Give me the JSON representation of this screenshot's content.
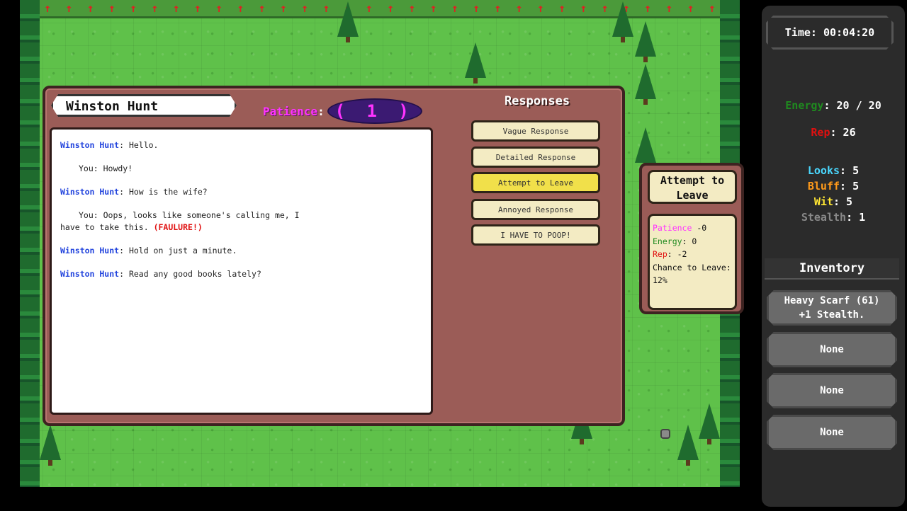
{
  "dialog": {
    "npc_name": "Winston Hunt",
    "patience_label": "Patience",
    "patience_value": "( 1 )",
    "messages": [
      {
        "speaker": "Winston Hunt",
        "text": ": Hello.",
        "is_you": false
      },
      {
        "speaker": "You",
        "text": "You: Howdy!",
        "is_you": true
      },
      {
        "speaker": "Winston Hunt",
        "text": ": How is the wife?",
        "is_you": false
      },
      {
        "speaker": "You",
        "text": "You: Oops, looks like someone's calling me, I have to take this.",
        "result": "(FAULURE!)",
        "is_you": true
      },
      {
        "speaker": "Winston Hunt",
        "text": ": Hold on just a minute.",
        "is_you": false
      },
      {
        "speaker": "Winston Hunt",
        "text": ": Read any good books lately?",
        "is_you": false
      }
    ],
    "responses_title": "Responses",
    "responses": [
      "Vague Response",
      "Detailed Response",
      "Attempt to Leave",
      "Annoyed Response",
      "I HAVE TO POOP!"
    ]
  },
  "action": {
    "title": "Attempt to Leave",
    "patience_label": "Patience",
    "patience_value": " -0",
    "energy_label": "Energy",
    "energy_value": ": 0",
    "rep_label": "Rep",
    "rep_value": ": -2",
    "chance_label": "Chance to Leave:",
    "chance_value": "12%"
  },
  "hud": {
    "time": "Time: 00:04:20",
    "energy_label": "Energy",
    "energy_value": ": 20 / 20",
    "rep_label": "Rep",
    "rep_value": ": 26",
    "looks_label": "Looks",
    "looks_value": ": 5",
    "bluff_label": "Bluff",
    "bluff_value": ": 5",
    "wit_label": "Wit",
    "wit_value": ": 5",
    "stealth_label": "Stealth",
    "stealth_value": ": 1",
    "inventory_title": "Inventory",
    "inventory": [
      {
        "line1": "Heavy Scarf (61)",
        "line2": "+1 Stealth."
      },
      {
        "line1": "None",
        "line2": ""
      },
      {
        "line1": "None",
        "line2": ""
      },
      {
        "line1": "None",
        "line2": ""
      }
    ]
  },
  "colors": {
    "grass": "#5fc14a",
    "dialog_bg": "#9b5c57",
    "patience": "#ff33ff",
    "speaker": "#2244dd",
    "failure": "#e01010",
    "active_response": "#f1e04a",
    "hud_bg": "#2b2b2b"
  },
  "icons": [
    "fence-arrow-icon",
    "tree-icon",
    "rock-icon"
  ]
}
